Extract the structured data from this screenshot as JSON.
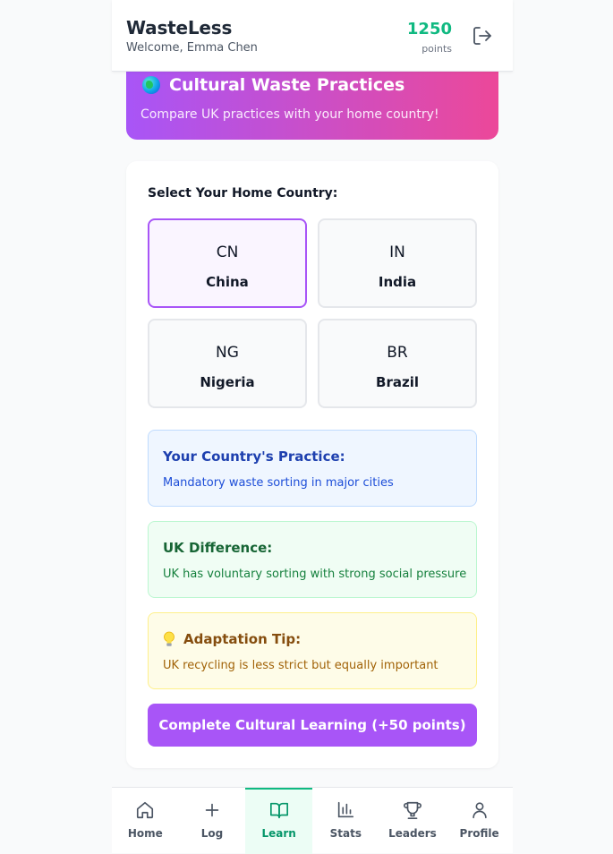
{
  "header": {
    "app_title": "WasteLess",
    "welcome": "Welcome, Emma Chen",
    "points_value": "1250",
    "points_label": "points",
    "logout_icon": "logout-icon"
  },
  "banner": {
    "title": "Cultural Waste Practices",
    "subtitle": "Compare UK practices with your home country!",
    "icon": "globe-icon"
  },
  "selector": {
    "label": "Select Your Home Country:",
    "countries": [
      {
        "code": "CN",
        "name": "China",
        "selected": true
      },
      {
        "code": "IN",
        "name": "India",
        "selected": false
      },
      {
        "code": "NG",
        "name": "Nigeria",
        "selected": false
      },
      {
        "code": "BR",
        "name": "Brazil",
        "selected": false
      }
    ]
  },
  "practice": {
    "title": "Your Country's Practice:",
    "text": "Mandatory waste sorting in major cities"
  },
  "difference": {
    "title": "UK Difference:",
    "text": "UK has voluntary sorting with strong social pressure"
  },
  "tip": {
    "title": "Adaptation Tip:",
    "text": "UK recycling is less strict but equally important",
    "icon": "lightbulb-icon"
  },
  "cta": {
    "label": "Complete Cultural Learning (+50 points)"
  },
  "nav": {
    "items": [
      {
        "label": "Home",
        "icon": "home-icon",
        "active": false
      },
      {
        "label": "Log",
        "icon": "plus-icon",
        "active": false
      },
      {
        "label": "Learn",
        "icon": "book-icon",
        "active": true
      },
      {
        "label": "Stats",
        "icon": "bar-chart-icon",
        "active": false
      },
      {
        "label": "Leaders",
        "icon": "trophy-icon",
        "active": false
      },
      {
        "label": "Profile",
        "icon": "user-icon",
        "active": false
      }
    ]
  },
  "colors": {
    "accent_green": "#10b981",
    "accent_purple": "#a855f7",
    "banner_gradient_end": "#ec4899"
  }
}
